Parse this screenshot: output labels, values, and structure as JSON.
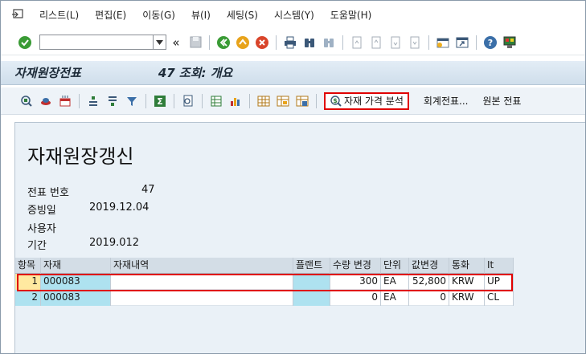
{
  "menu": {
    "items": [
      "리스트(L)",
      "편집(E)",
      "이동(G)",
      "뷰(I)",
      "세팅(S)",
      "시스템(Y)",
      "도움말(H)"
    ]
  },
  "std_toolbar": {
    "command_value": "",
    "nav_symbol": "«"
  },
  "title": {
    "main": "자재원장전표",
    "sub": "47 조회: 개요"
  },
  "app_toolbar": {
    "material_price_analysis": "자재 가격 분석",
    "accounting_doc": "회계전표...",
    "original_doc": "원본 전표"
  },
  "report": {
    "title": "자재원장갱신",
    "fields": [
      {
        "label": "전표 번호",
        "value": "47"
      },
      {
        "label": "증빙일",
        "value": "2019.12.04"
      },
      {
        "label": "사용자",
        "value": ""
      },
      {
        "label": "기간",
        "value": "2019.012"
      }
    ]
  },
  "table": {
    "headers": [
      "항목",
      "자재",
      "자재내역",
      "플랜트",
      "수량 변경",
      "단위",
      "값변경",
      "통화",
      "It"
    ],
    "rows": [
      [
        "1",
        "000083",
        "",
        "",
        "300",
        "EA",
        "52,800",
        "KRW",
        "UP"
      ],
      [
        "2",
        "000083",
        "",
        "",
        "0",
        "EA",
        "0",
        "KRW",
        "CL"
      ]
    ]
  },
  "colors": {
    "highlight_red": "#e00000",
    "header_bg": "#d3dde6",
    "cyan_cell": "#aee2f0",
    "selected_cell": "#ffe9a0",
    "title_bar": "#d9e6f1"
  }
}
